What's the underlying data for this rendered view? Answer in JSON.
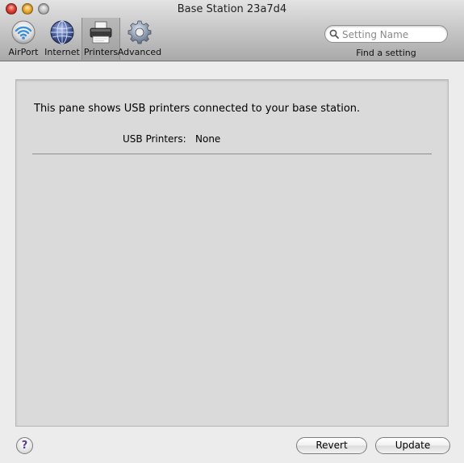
{
  "window": {
    "title": "Base Station 23a7d4"
  },
  "toolbar": {
    "items": [
      {
        "label": "AirPort",
        "icon": "airport-icon"
      },
      {
        "label": "Internet",
        "icon": "globe-icon"
      },
      {
        "label": "Printers",
        "icon": "printer-icon",
        "selected": true
      },
      {
        "label": "Advanced",
        "icon": "gear-icon"
      }
    ]
  },
  "search": {
    "placeholder": "Setting Name",
    "value": "",
    "caption": "Find a setting"
  },
  "pane": {
    "description": "This pane shows USB printers connected to your base station.",
    "usb_printers_label": "USB Printers:",
    "usb_printers_value": "None"
  },
  "buttons": {
    "help": "?",
    "revert": "Revert",
    "update": "Update"
  },
  "colors": {
    "close": "#e2463b",
    "minimize": "#f0b23c",
    "zoom": "#c8c8c8",
    "help_glyph": "#5a3aa0"
  }
}
